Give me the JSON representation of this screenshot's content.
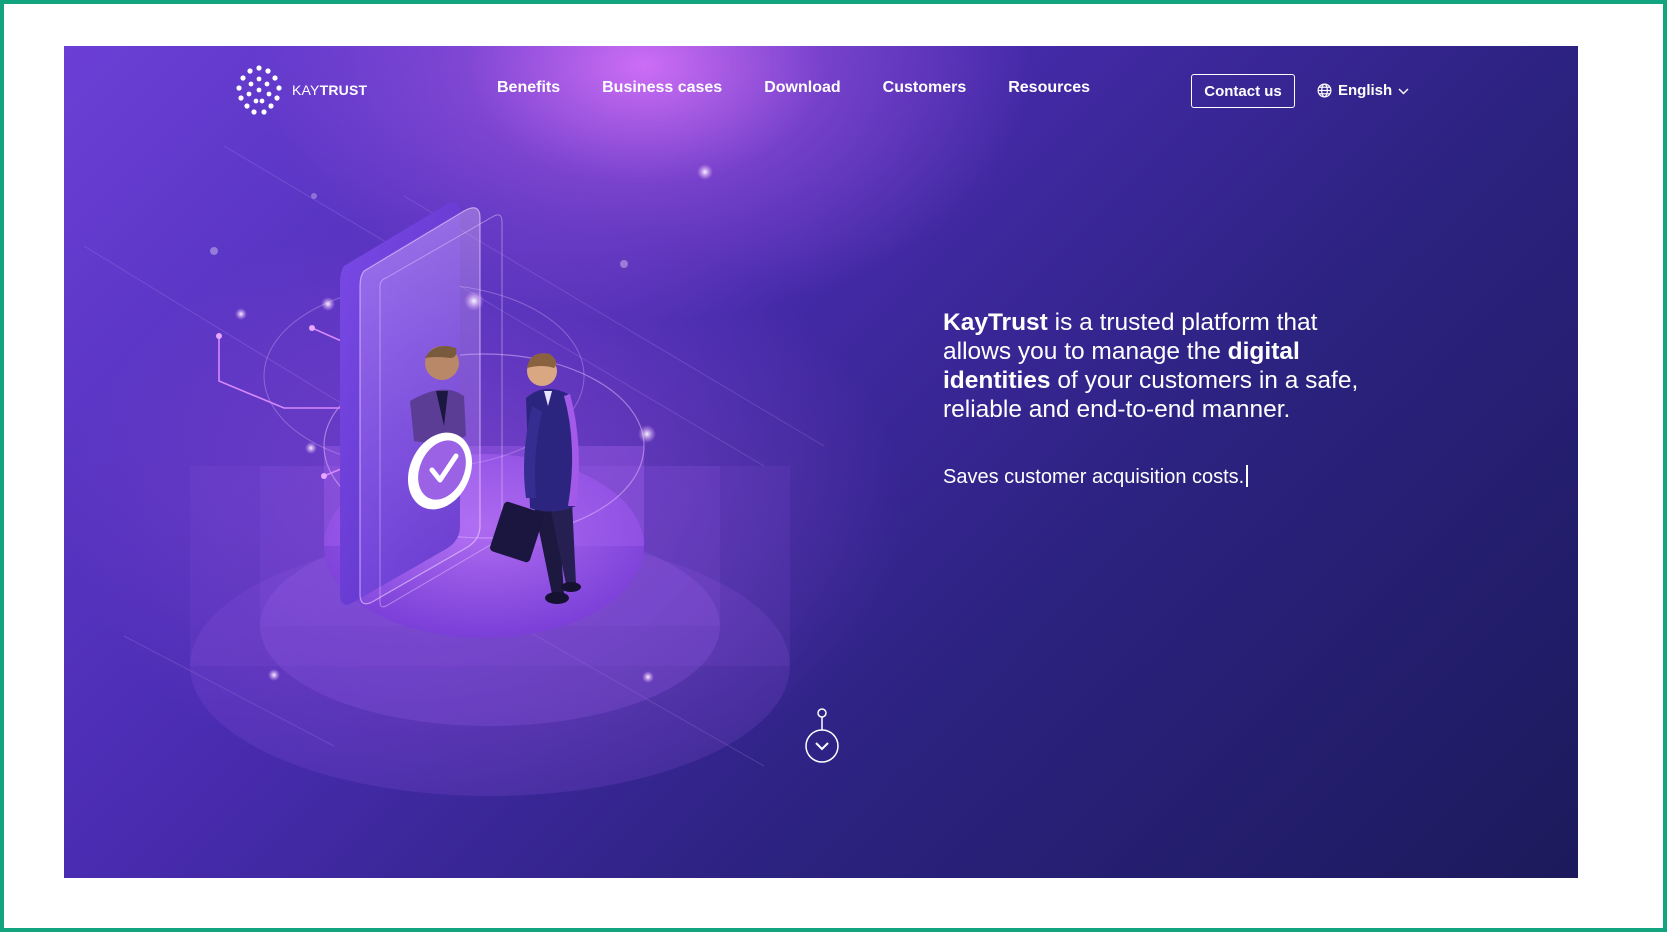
{
  "brand": {
    "logo_prefix": "KAY",
    "logo_suffix": "TRUST",
    "logo_icon": "dot-cluster-logo"
  },
  "nav": {
    "items": [
      {
        "label": "Benefits"
      },
      {
        "label": "Business cases"
      },
      {
        "label": "Download"
      },
      {
        "label": "Customers"
      },
      {
        "label": "Resources"
      }
    ],
    "contact_label": "Contact us",
    "language": {
      "label": "English",
      "icon": "globe-icon",
      "chevron": "chevron-down-icon"
    }
  },
  "hero": {
    "headline": {
      "part1_bold": "KayTrust",
      "part2": " is a trusted platform that allows you to manage the ",
      "part3_bold": "digital identities",
      "part4": " of your customers in a safe, reliable and end-to-end manner."
    },
    "tagline": "Saves customer acquisition costs.",
    "illustration": "businessman-phone-shield-illustration",
    "scroll_icon": "scroll-down-icon"
  },
  "colors": {
    "frame_border": "#12a37f",
    "hero_top": "#6b3fd6",
    "hero_bottom": "#1c1a5c",
    "glow": "#e278ff",
    "text": "#ffffff"
  }
}
